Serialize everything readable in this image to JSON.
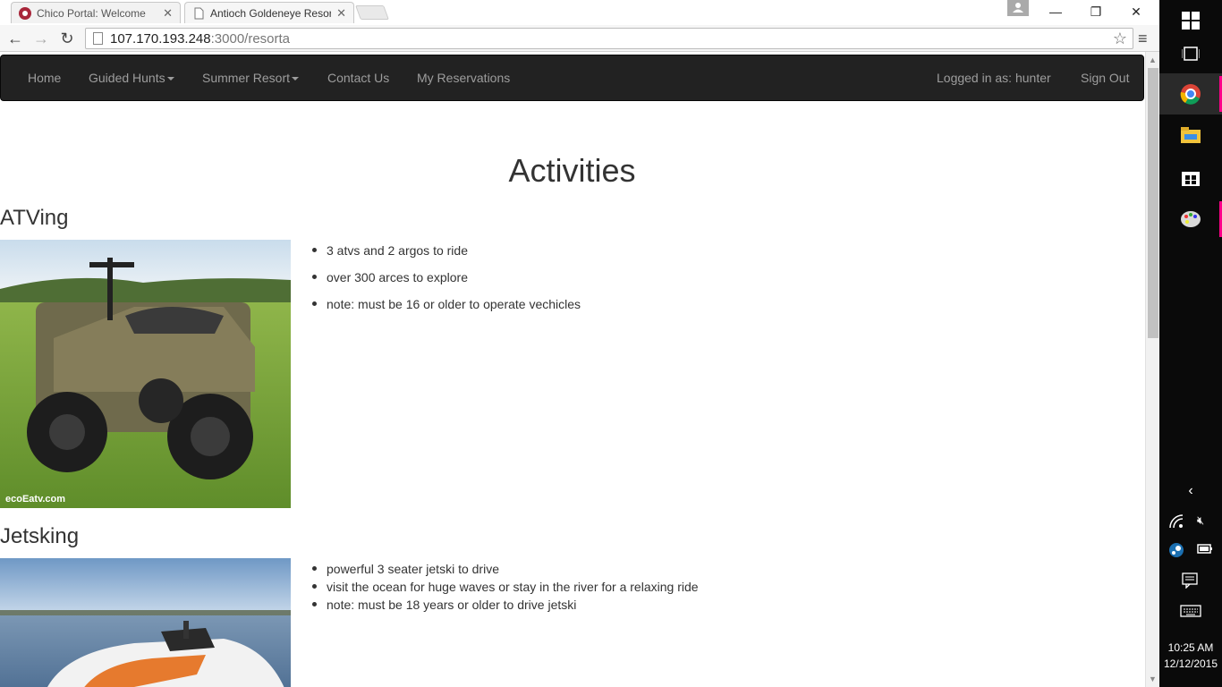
{
  "browser": {
    "tabs": [
      {
        "label": "Chico Portal: Welcome",
        "active": false
      },
      {
        "label": "Antioch Goldeneye Resort",
        "active": true
      }
    ],
    "url_host": "107.170.193.248",
    "url_path": ":3000/resorta"
  },
  "navbar": {
    "items": [
      "Home",
      "Guided Hunts",
      "Summer Resort",
      "Contact Us",
      "My Reservations"
    ],
    "logged_in": "Logged in as: hunter",
    "sign_out": "Sign Out"
  },
  "page": {
    "title": "Activities",
    "activities": [
      {
        "name": "ATVing",
        "watermark": "ecoEatv.com",
        "bullets": [
          "3 atvs and 2 argos to ride",
          "over 300 arces to explore",
          "note: must be 16 or older to operate vechicles"
        ]
      },
      {
        "name": "Jetsking",
        "bullets": [
          "powerful 3 seater jetski to drive",
          "visit the ocean for huge waves or stay in the river for a relaxing ride",
          "note: must be 18 years or older to drive jetski"
        ]
      }
    ]
  },
  "taskbar": {
    "time": "10:25 AM",
    "date": "12/12/2015"
  },
  "colors": {
    "navbar_bg": "#222222",
    "navbar_text": "#9d9d9d",
    "taskbar_bg": "#0a0a0a",
    "active_indicator": "#ff0088"
  }
}
